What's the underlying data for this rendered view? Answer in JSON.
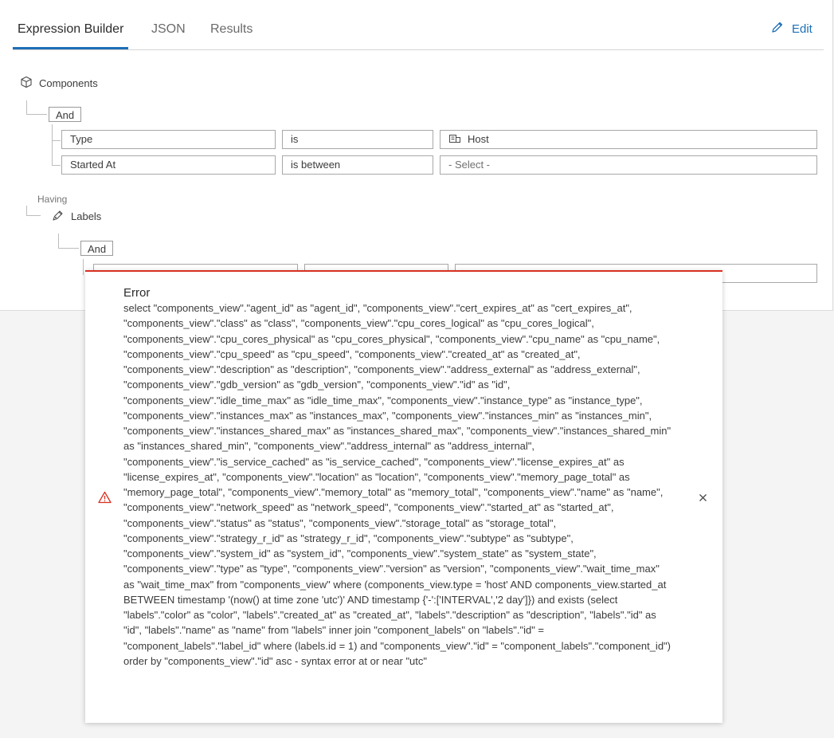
{
  "tabs": [
    {
      "label": "Expression Builder",
      "active": true
    },
    {
      "label": "JSON",
      "active": false
    },
    {
      "label": "Results",
      "active": false
    }
  ],
  "edit_label": "Edit",
  "builder": {
    "root_label": "Components",
    "and_label": "And",
    "rows": [
      {
        "field": "Type",
        "operator": "is",
        "value": "Host"
      },
      {
        "field": "Started At",
        "operator": "is between",
        "value": "- Select -"
      }
    ],
    "having_label": "Having",
    "labels_node": "Labels",
    "labels_and_label": "And"
  },
  "error": {
    "title": "Error",
    "message": "select \"components_view\".\"agent_id\" as \"agent_id\", \"components_view\".\"cert_expires_at\" as \"cert_expires_at\", \"components_view\".\"class\" as \"class\", \"components_view\".\"cpu_cores_logical\" as \"cpu_cores_logical\", \"components_view\".\"cpu_cores_physical\" as \"cpu_cores_physical\", \"components_view\".\"cpu_name\" as \"cpu_name\", \"components_view\".\"cpu_speed\" as \"cpu_speed\", \"components_view\".\"created_at\" as \"created_at\", \"components_view\".\"description\" as \"description\", \"components_view\".\"address_external\" as \"address_external\", \"components_view\".\"gdb_version\" as \"gdb_version\", \"components_view\".\"id\" as \"id\", \"components_view\".\"idle_time_max\" as \"idle_time_max\", \"components_view\".\"instance_type\" as \"instance_type\", \"components_view\".\"instances_max\" as \"instances_max\", \"components_view\".\"instances_min\" as \"instances_min\", \"components_view\".\"instances_shared_max\" as \"instances_shared_max\", \"components_view\".\"instances_shared_min\" as \"instances_shared_min\", \"components_view\".\"address_internal\" as \"address_internal\", \"components_view\".\"is_service_cached\" as \"is_service_cached\", \"components_view\".\"license_expires_at\" as \"license_expires_at\", \"components_view\".\"location\" as \"location\", \"components_view\".\"memory_page_total\" as \"memory_page_total\", \"components_view\".\"memory_total\" as \"memory_total\", \"components_view\".\"name\" as \"name\", \"components_view\".\"network_speed\" as \"network_speed\", \"components_view\".\"started_at\" as \"started_at\", \"components_view\".\"status\" as \"status\", \"components_view\".\"storage_total\" as \"storage_total\", \"components_view\".\"strategy_r_id\" as \"strategy_r_id\", \"components_view\".\"subtype\" as \"subtype\", \"components_view\".\"system_id\" as \"system_id\", \"components_view\".\"system_state\" as \"system_state\", \"components_view\".\"type\" as \"type\", \"components_view\".\"version\" as \"version\", \"components_view\".\"wait_time_max\" as \"wait_time_max\" from \"components_view\" where (components_view.type = 'host' AND components_view.started_at BETWEEN timestamp '(now() at time zone 'utc')' AND timestamp {'-':['INTERVAL','2 day']}) and exists (select \"labels\".\"color\" as \"color\", \"labels\".\"created_at\" as \"created_at\", \"labels\".\"description\" as \"description\", \"labels\".\"id\" as \"id\", \"labels\".\"name\" as \"name\" from \"labels\" inner join \"component_labels\" on \"labels\".\"id\" = \"component_labels\".\"label_id\" where (labels.id = 1) and \"components_view\".\"id\" = \"component_labels\".\"component_id\") order by \"components_view\".\"id\" asc - syntax error at or near \"utc\""
  },
  "colors": {
    "accent": "#1f6fb6",
    "error": "#d83020"
  },
  "icons": {
    "edit": "pencil-icon",
    "components": "cube-icon",
    "host": "server-icon",
    "labels": "tag-icon",
    "warning": "warning-icon",
    "close": "close-icon"
  }
}
